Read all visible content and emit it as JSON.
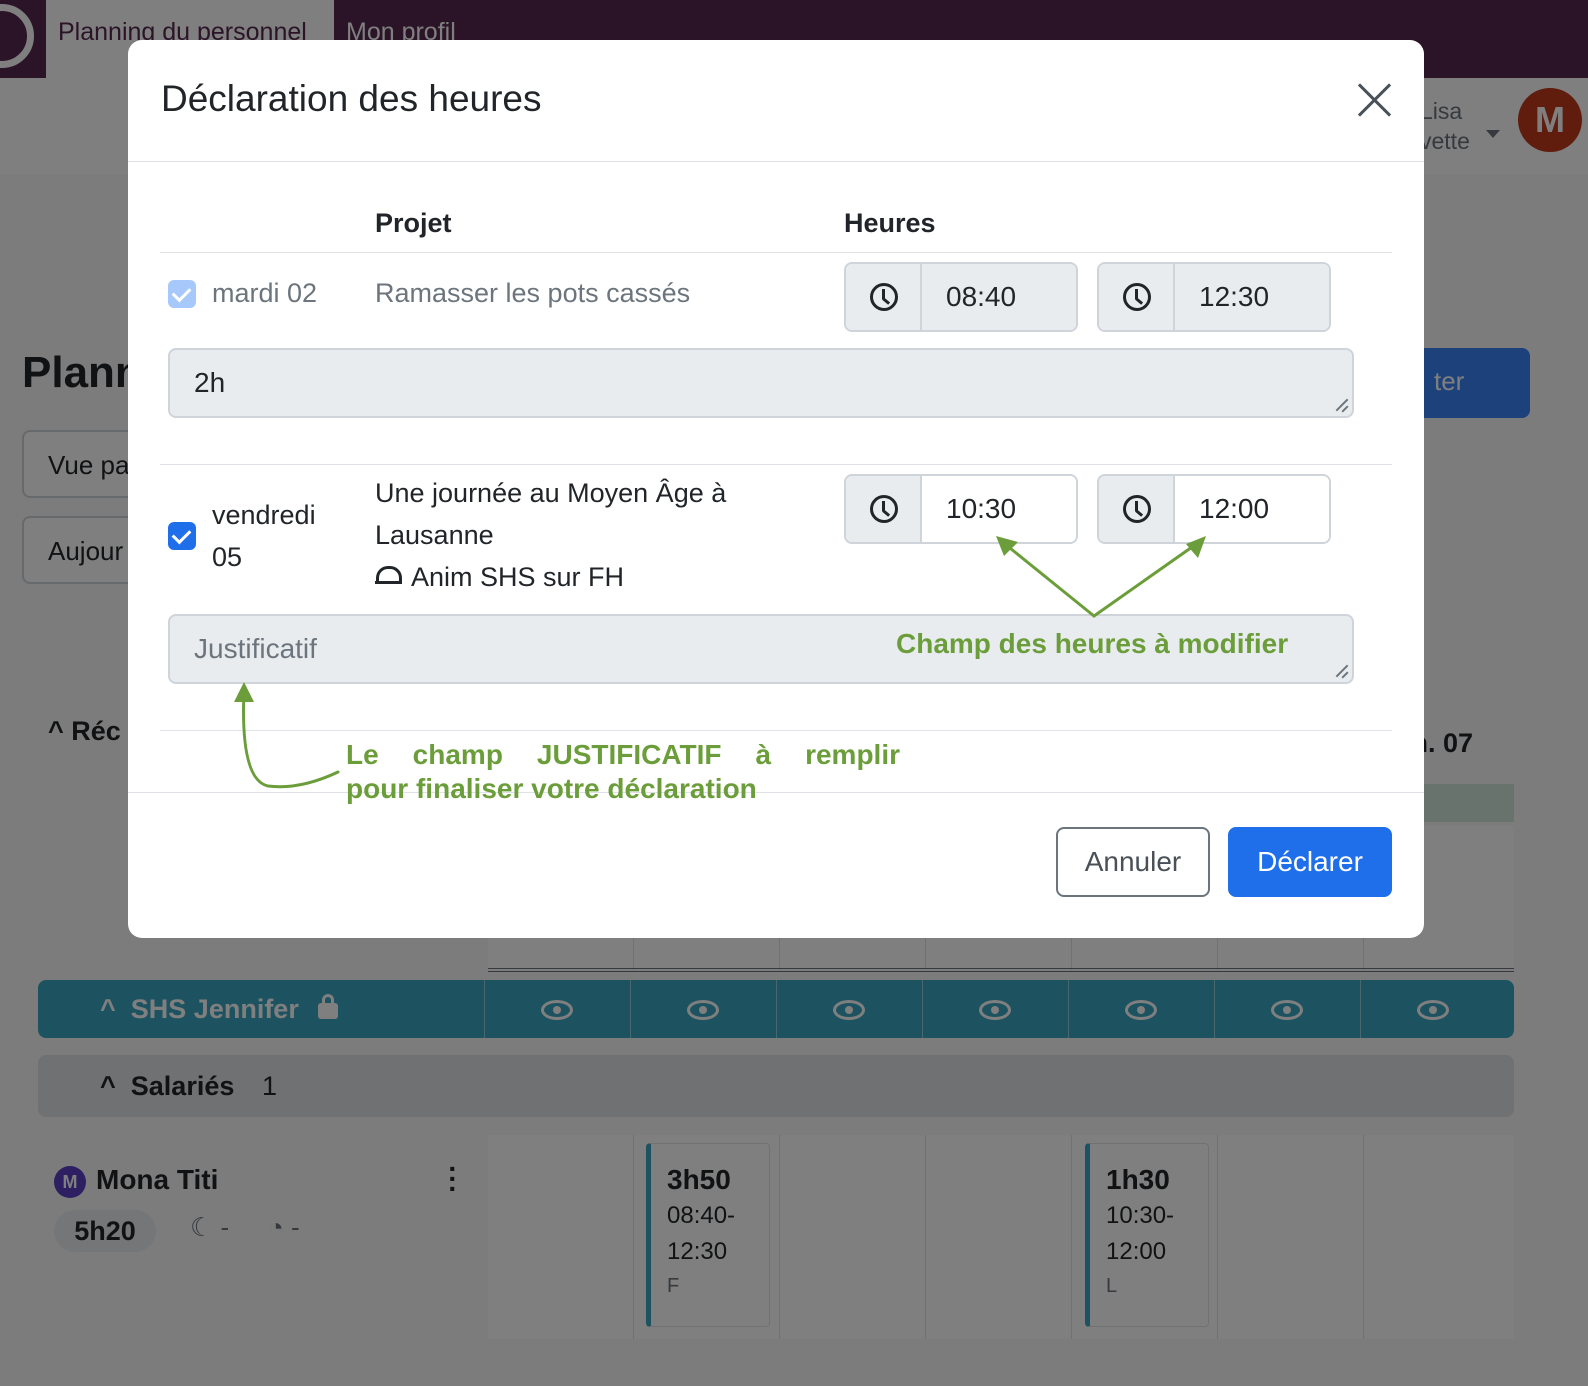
{
  "app": {
    "tabs": [
      {
        "label": "Planning du personnel"
      },
      {
        "label": "Mon profil"
      }
    ],
    "user": {
      "name_line1": "Lisa",
      "name_line2": "vette",
      "avatar_letter": "M"
    }
  },
  "page": {
    "title_fragment": "Plann",
    "primary_button_fragment": "ter",
    "view_select_fragment": "Vue pa",
    "today_button_fragment": "Aujour",
    "section_fragment": "Réc",
    "day_head_fragment": "m. 07"
  },
  "groups": {
    "team": {
      "label": "SHS Jennifer",
      "locked": true
    },
    "salaries": {
      "label": "Salariés",
      "count": "1"
    }
  },
  "employee": {
    "initial": "M",
    "name": "Mona Titi",
    "total": "5h20",
    "night": "-",
    "overtime": "-",
    "shifts": [
      {
        "duration": "3h50",
        "start": "08:40-",
        "end": "12:30",
        "frag": "F"
      },
      {
        "duration": "1h30",
        "start": "10:30-",
        "end": "12:00",
        "frag": "L"
      }
    ]
  },
  "modal": {
    "title": "Déclaration des heures",
    "col_project": "Projet",
    "col_hours": "Heures",
    "rows": [
      {
        "checked": true,
        "disabled": true,
        "day": "mardi 02",
        "project": "Ramasser les pots cassés",
        "start": "08:40",
        "end": "12:30",
        "comment": "2h"
      },
      {
        "checked": true,
        "disabled": false,
        "day_line1": "vendredi",
        "day_line2": "05",
        "project_line1": "Une journée au Moyen Âge à",
        "project_line2": "Lausanne",
        "team": "Anim SHS sur FH",
        "start": "10:30",
        "end": "12:00",
        "comment_placeholder": "Justificatif"
      }
    ],
    "cancel_label": "Annuler",
    "submit_label": "Déclarer"
  },
  "annotations": {
    "hours_note": "Champ des heures à modifier",
    "justif_note_line1": "Le champ JUSTIFICATIF à remplir",
    "justif_note_line2": "pour finaliser votre déclaration",
    "color": "#6b9e3a"
  }
}
